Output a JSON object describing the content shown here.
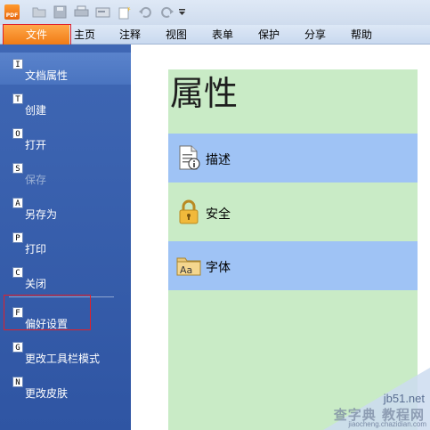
{
  "quick_access": {
    "app_logo_text": "PDF",
    "icons": [
      "app-logo",
      "open-folder-icon",
      "save-icon",
      "print-icon",
      "scan-icon",
      "new-document-icon",
      "undo-icon",
      "redo-icon",
      "customize-dropdown-icon"
    ]
  },
  "tabs": [
    {
      "label": "文件",
      "active": true
    },
    {
      "label": "主页"
    },
    {
      "label": "注释"
    },
    {
      "label": "视图"
    },
    {
      "label": "表单"
    },
    {
      "label": "保护"
    },
    {
      "label": "分享"
    },
    {
      "label": "帮助"
    }
  ],
  "menu": {
    "items": [
      {
        "key": "I",
        "label": "文档属性",
        "selected": true
      },
      {
        "key": "T",
        "label": "创建"
      },
      {
        "key": "O",
        "label": "打开"
      },
      {
        "key": "S",
        "label": "保存",
        "disabled": true
      },
      {
        "key": "A",
        "label": "另存为"
      },
      {
        "key": "P",
        "label": "打印"
      },
      {
        "key": "C",
        "label": "关闭"
      },
      {
        "key": "F",
        "label": "偏好设置"
      },
      {
        "key": "G",
        "label": "更改工具栏模式"
      },
      {
        "key": "N",
        "label": "更改皮肤"
      }
    ]
  },
  "properties": {
    "title": "属性",
    "rows": [
      {
        "label": "描述",
        "icon": "document-info-icon"
      },
      {
        "label": "安全",
        "icon": "padlock-icon"
      },
      {
        "label": "字体",
        "icon": "font-folder-icon"
      }
    ]
  },
  "watermark": {
    "site": "jb51.net",
    "text": "查字典 教程网",
    "url": "jiaocheng.chazidian.com"
  },
  "colors": {
    "file_tab": "#f07b14",
    "menu_bg": "#3a61b0",
    "panel_bg": "#c9ebc6",
    "row_highlight": "#9fc3f5",
    "highlight_border": "#e0202a"
  }
}
